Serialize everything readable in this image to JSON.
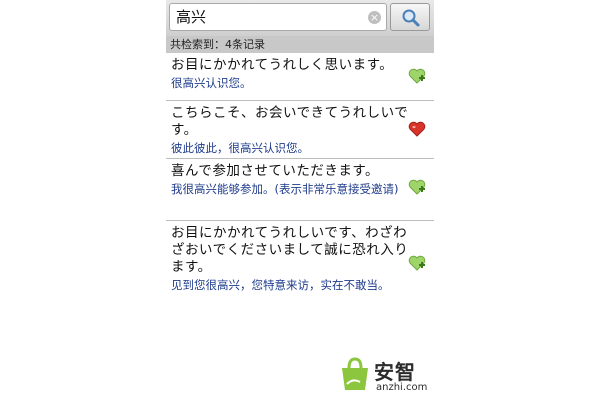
{
  "search": {
    "query": "高兴",
    "clear_glyph": "×",
    "button_icon": "magnifier-icon"
  },
  "results": {
    "count_text": "共检索到：4条记录",
    "items": [
      {
        "japanese": "お目にかかれてうれしく思います。",
        "chinese": "很高兴认识您。",
        "icon": "add-favorite-icon",
        "favorited": false
      },
      {
        "japanese": "こちらこそ、お会いできてうれしいです。",
        "chinese": "彼此彼此，很高兴认识您。",
        "icon": "favorited-heart-icon",
        "favorited": true
      },
      {
        "japanese": "喜んで参加させていただきます。",
        "chinese": "我很高兴能够参加。(表示非常乐意接受邀请)",
        "icon": "add-favorite-icon",
        "favorited": false
      },
      {
        "japanese": "お目にかかれてうれしいです、わざわざおいでくださいまして誠に恐れ入ります。",
        "chinese": "见到您很高兴，您特意来访，实在不敢当。",
        "icon": "add-favorite-icon",
        "favorited": false
      }
    ]
  },
  "watermark": {
    "brand": "安智",
    "site": "anzhi.com"
  },
  "colors": {
    "chinese_text": "#1f3c8c",
    "heart": "#d9342b",
    "add_heart": "#7fbf3f"
  }
}
